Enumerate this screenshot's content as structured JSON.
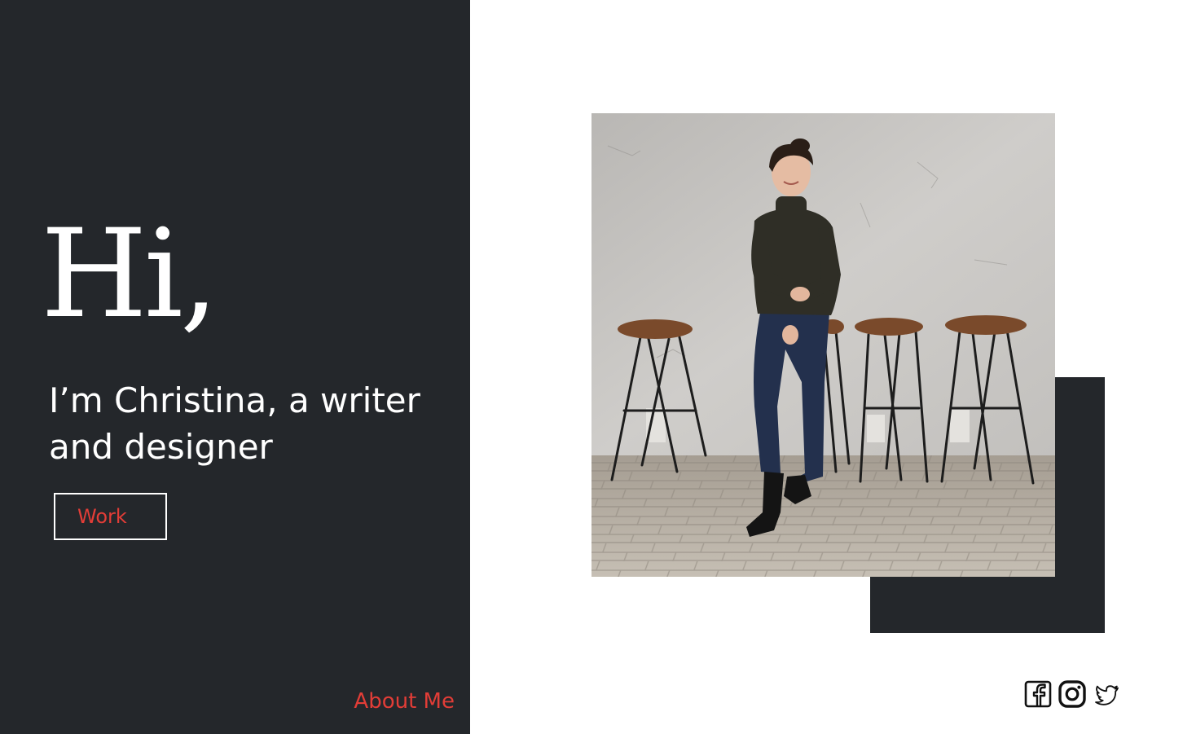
{
  "hero": {
    "greeting": "Hi,",
    "intro": "I’m Christina, a writer and designer",
    "work_button_label": "Work"
  },
  "footer": {
    "about_link_label": "About Me"
  },
  "social": {
    "icons": [
      "facebook-icon",
      "instagram-icon",
      "twitter-icon"
    ]
  },
  "colors": {
    "dark_panel": "#24272b",
    "accent_red": "#e23d37",
    "background": "#ffffff"
  }
}
